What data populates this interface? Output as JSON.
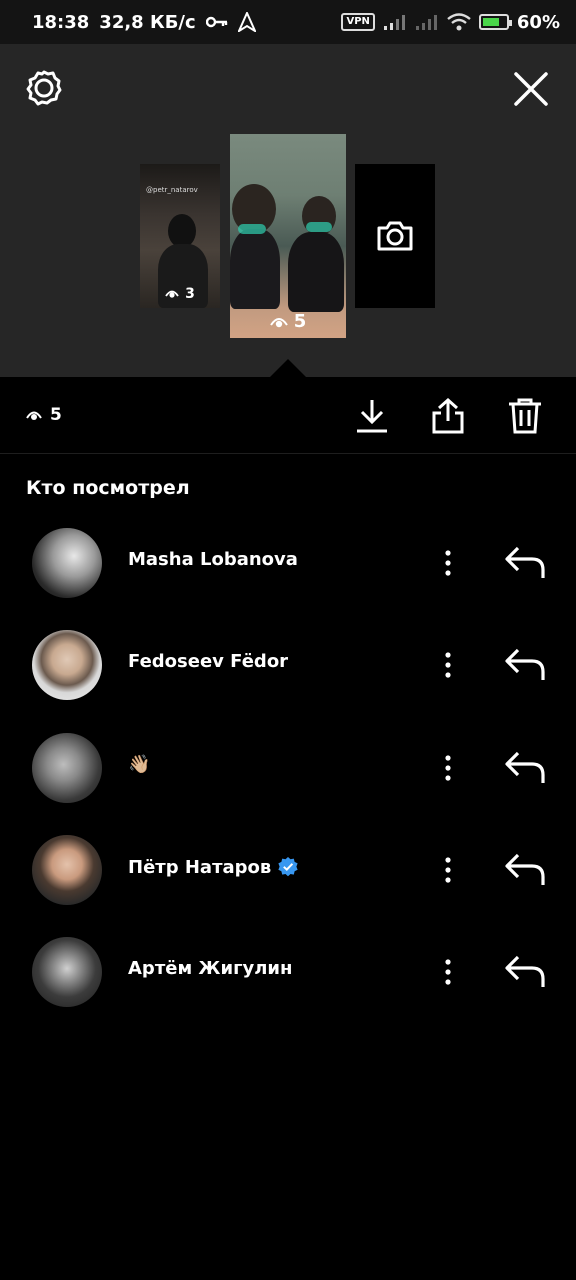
{
  "status_bar": {
    "time": "18:38",
    "speed": "32,8 КБ/с",
    "vpn": "VPN",
    "battery": "60%",
    "battery_level": 0.6
  },
  "top_panel": {
    "thumbnails": [
      {
        "tag": "@petr_natarov",
        "views": "3"
      },
      {
        "views": "5"
      },
      {
        "icon": "camera-icon"
      }
    ]
  },
  "actions": {
    "views": "5",
    "icons": [
      "eye-icon",
      "download-icon",
      "share-icon",
      "trash-icon"
    ]
  },
  "viewers": {
    "title": "Кто посмотрел",
    "items": [
      {
        "name": "Masha Lobanova",
        "verified": false
      },
      {
        "name": "Fedoseev Fëdor",
        "verified": false
      },
      {
        "name": "👋🏼",
        "verified": false
      },
      {
        "name": "Пётр Натаров",
        "verified": true
      },
      {
        "name": "Артём Жигулин",
        "verified": false
      }
    ]
  },
  "colors": {
    "background": "#000000",
    "panel": "#262626",
    "verified": "#3897f0"
  }
}
